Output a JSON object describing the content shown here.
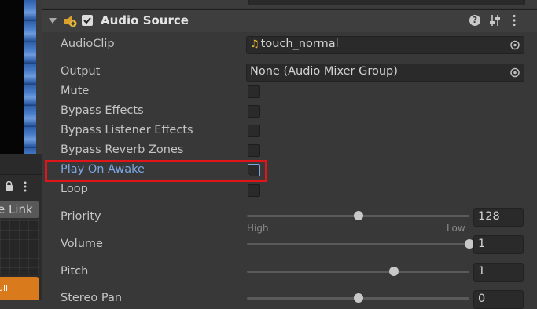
{
  "left_panel": {
    "link_button_label": "e Link",
    "node_label": "ull"
  },
  "component": {
    "title": "Audio Source",
    "enabled": true
  },
  "properties": {
    "audio_clip": {
      "label": "AudioClip",
      "value": "touch_normal"
    },
    "output": {
      "label": "Output",
      "value": "None (Audio Mixer Group)"
    },
    "mute": {
      "label": "Mute",
      "checked": false
    },
    "bypass_effects": {
      "label": "Bypass Effects",
      "checked": false
    },
    "bypass_listener_effects": {
      "label": "Bypass Listener Effects",
      "checked": false
    },
    "bypass_reverb_zones": {
      "label": "Bypass Reverb Zones",
      "checked": false
    },
    "play_on_awake": {
      "label": "Play On Awake",
      "checked": false,
      "highlighted": true
    },
    "loop": {
      "label": "Loop",
      "checked": false
    },
    "priority": {
      "label": "Priority",
      "value": "128",
      "min_label": "High",
      "max_label": "Low",
      "fraction": 0.5
    },
    "volume": {
      "label": "Volume",
      "value": "1",
      "fraction": 1.0
    },
    "pitch": {
      "label": "Pitch",
      "value": "1",
      "fraction": 0.66
    },
    "stereo_pan": {
      "label": "Stereo Pan",
      "value": "0",
      "fraction": 0.5
    }
  },
  "colors": {
    "highlight": "#e0151a",
    "focus_label": "#7ba7e3",
    "audio_note": "#e8b73a"
  },
  "icons": {
    "fold": "triangle-down-icon",
    "component": "audio-source-icon",
    "help": "help-icon",
    "presets": "presets-icon",
    "menu": "kebab-menu-icon",
    "picker": "object-picker-icon",
    "lock": "lock-icon"
  }
}
